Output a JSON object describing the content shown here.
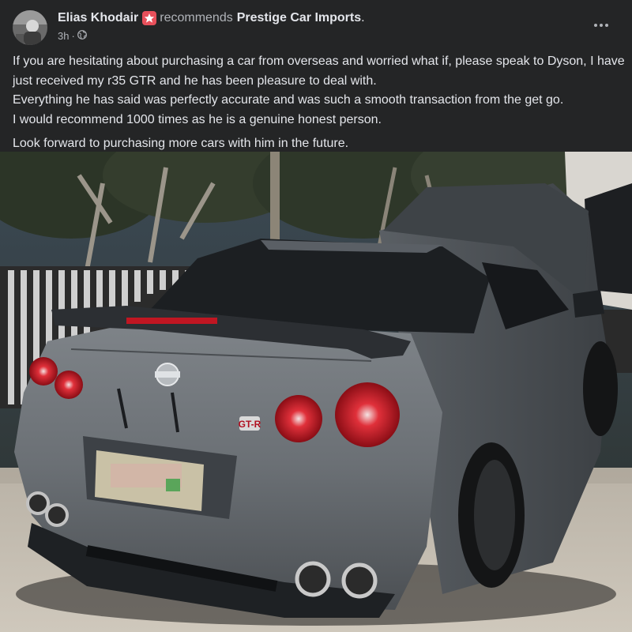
{
  "post": {
    "author": "Elias Khodair",
    "verb": "recommends",
    "page": "Prestige Car Imports",
    "trailing_dot": ".",
    "time": "3h",
    "separator": "·",
    "paragraphs": [
      "If you are hesitating about purchasing a car from overseas and worried what if, please speak to Dyson, I have just received my r35 GTR and he has been pleasure to deal with.",
      "Everything he has said was perfectly accurate and was such a smooth transaction from the get go.",
      "I would recommend 1000 times as he is a genuine honest person.",
      "Look forward to purchasing more cars with him in the future."
    ]
  },
  "icons": {
    "recommend": "recommend-star-icon",
    "audience": "globe-icon",
    "more": "more-options-icon"
  },
  "photo": {
    "badge": "GT-R"
  },
  "colors": {
    "background": "#242526",
    "primary_text": "#e4e6eb",
    "secondary_text": "#b0b3b8",
    "recommend_badge": "#e8505b"
  }
}
